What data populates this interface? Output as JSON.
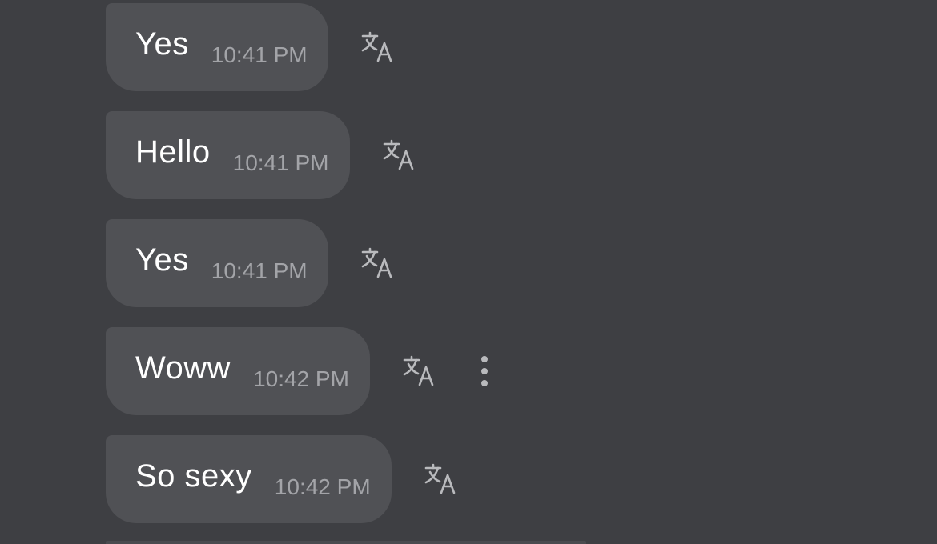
{
  "messages": [
    {
      "text": "Yes",
      "time": "10:41 PM",
      "has_more_menu": false
    },
    {
      "text": "Hello",
      "time": "10:41 PM",
      "has_more_menu": false
    },
    {
      "text": "Yes",
      "time": "10:41 PM",
      "has_more_menu": false
    },
    {
      "text": "Woww",
      "time": "10:42 PM",
      "has_more_menu": true
    },
    {
      "text": "So sexy",
      "time": "10:42 PM",
      "has_more_menu": false
    }
  ],
  "icons": {
    "translate": "translate-icon",
    "more": "more-vertical-icon"
  },
  "colors": {
    "background": "#3e3f43",
    "bubble": "#505155",
    "text": "#ffffff",
    "timestamp": "#a3a4a8",
    "icon": "#b9babd"
  }
}
